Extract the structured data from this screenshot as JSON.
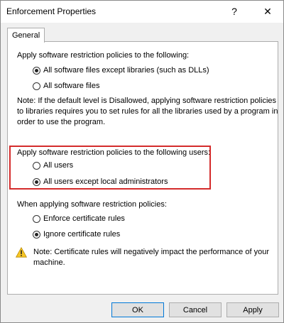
{
  "window": {
    "title": "Enforcement Properties",
    "help_label": "?",
    "close_label": "✕"
  },
  "tabs": [
    {
      "label": "General"
    }
  ],
  "section1": {
    "heading": "Apply software restriction policies to the following:",
    "options": [
      {
        "label": "All software files except libraries (such as DLLs)",
        "selected": true
      },
      {
        "label": "All software files",
        "selected": false
      }
    ],
    "note_lines": [
      "Note:  If the default level is Disallowed, applying software restriction policies",
      "to libraries requires you to set rules for all the libraries used by a program in",
      "order to use the program."
    ]
  },
  "section2": {
    "heading": "Apply software restriction policies to the following users:",
    "options": [
      {
        "label": "All users",
        "selected": false
      },
      {
        "label": "All users except local administrators",
        "selected": true
      }
    ]
  },
  "section3": {
    "heading": "When applying software restriction policies:",
    "options": [
      {
        "label": "Enforce certificate rules",
        "selected": false
      },
      {
        "label": "Ignore certificate rules",
        "selected": true
      }
    ],
    "warning_lines": [
      "Note:  Certificate rules will negatively impact the performance of your",
      "machine."
    ]
  },
  "buttons": {
    "ok": "OK",
    "cancel": "Cancel",
    "apply": "Apply"
  },
  "colors": {
    "highlight_border": "#d42b2b",
    "warning_fill": "#f7c625"
  }
}
